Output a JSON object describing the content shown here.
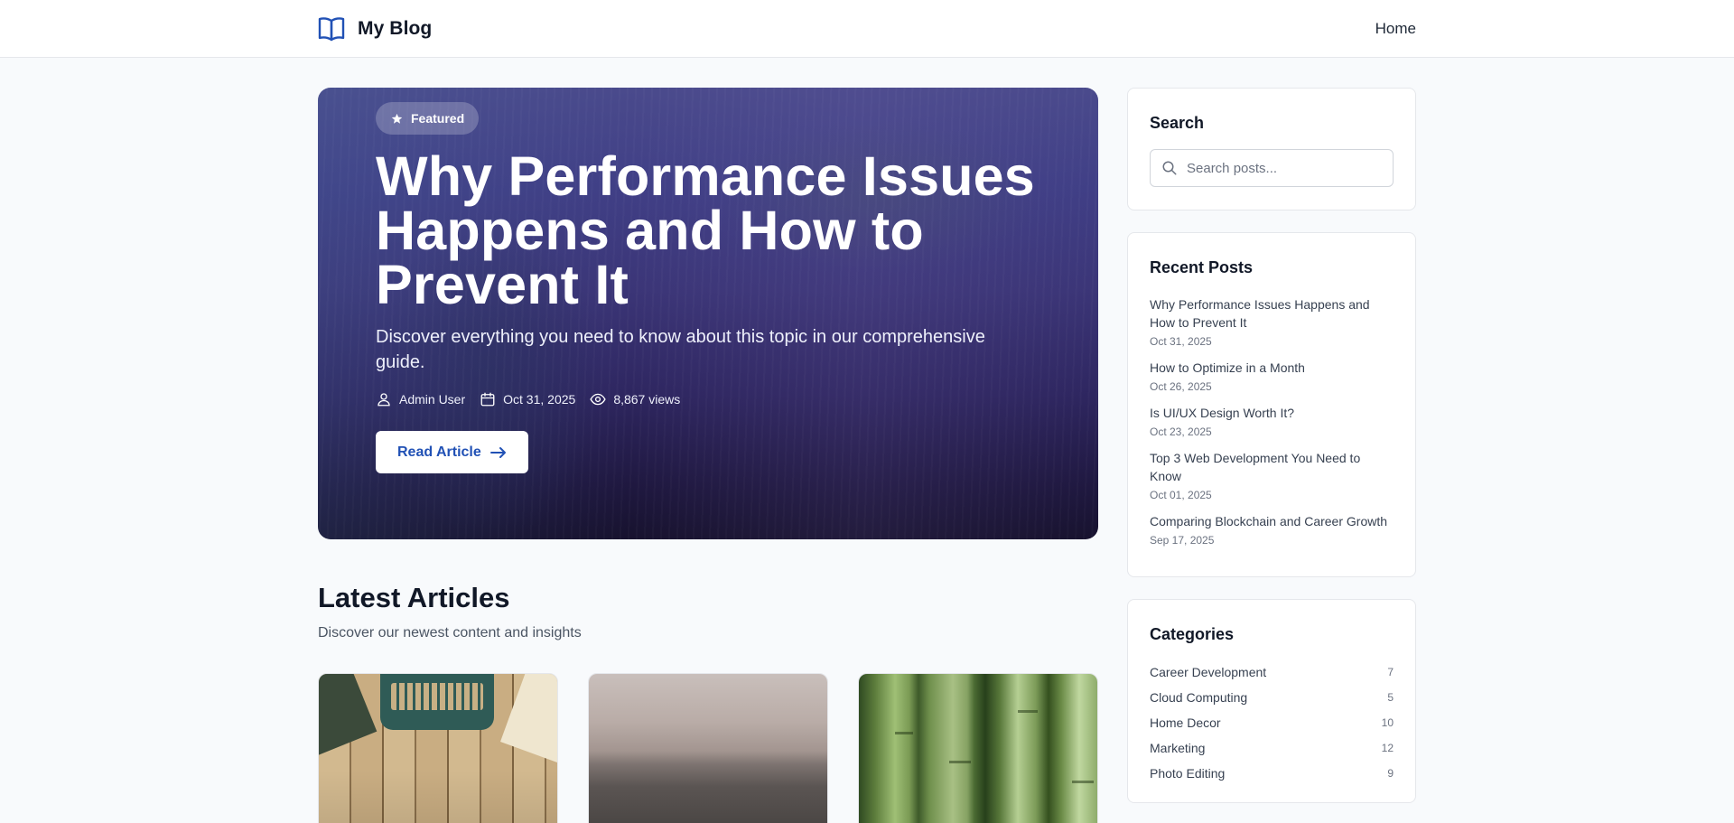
{
  "header": {
    "brand": "My Blog",
    "nav": {
      "home": "Home"
    }
  },
  "hero": {
    "badge": "Featured",
    "title": "Why Performance Issues Happens and How to Prevent It",
    "subtitle": "Discover everything you need to know about this topic in our comprehensive guide.",
    "author": "Admin User",
    "date": "Oct 31, 2025",
    "views": "8,867 views",
    "cta": "Read Article"
  },
  "latest": {
    "title": "Latest Articles",
    "subtitle": "Discover our newest content and insights"
  },
  "sidebar": {
    "search": {
      "title": "Search",
      "placeholder": "Search posts..."
    },
    "recent": {
      "title": "Recent Posts",
      "items": [
        {
          "title": "Why Performance Issues Happens and How to Prevent It",
          "date": "Oct 31, 2025"
        },
        {
          "title": "How to Optimize in a Month",
          "date": "Oct 26, 2025"
        },
        {
          "title": "Is UI/UX Design Worth It?",
          "date": "Oct 23, 2025"
        },
        {
          "title": "Top 3 Web Development You Need to Know",
          "date": "Oct 01, 2025"
        },
        {
          "title": "Comparing Blockchain and Career Growth",
          "date": "Sep 17, 2025"
        }
      ]
    },
    "categories": {
      "title": "Categories",
      "items": [
        {
          "name": "Career Development",
          "count": "7"
        },
        {
          "name": "Cloud Computing",
          "count": "5"
        },
        {
          "name": "Home Decor",
          "count": "10"
        },
        {
          "name": "Marketing",
          "count": "12"
        },
        {
          "name": "Photo Editing",
          "count": "9"
        }
      ]
    }
  },
  "colors": {
    "accent": "#2151b5",
    "page_background": "#f8fafc",
    "hero_top": "#4a4a8c",
    "hero_bottom": "#17122e"
  },
  "icons": {
    "brand": "book-open-icon",
    "badge": "star-icon",
    "author": "user-icon",
    "date": "calendar-icon",
    "views": "eye-icon",
    "cta": "arrow-right-icon",
    "search": "search-icon"
  }
}
